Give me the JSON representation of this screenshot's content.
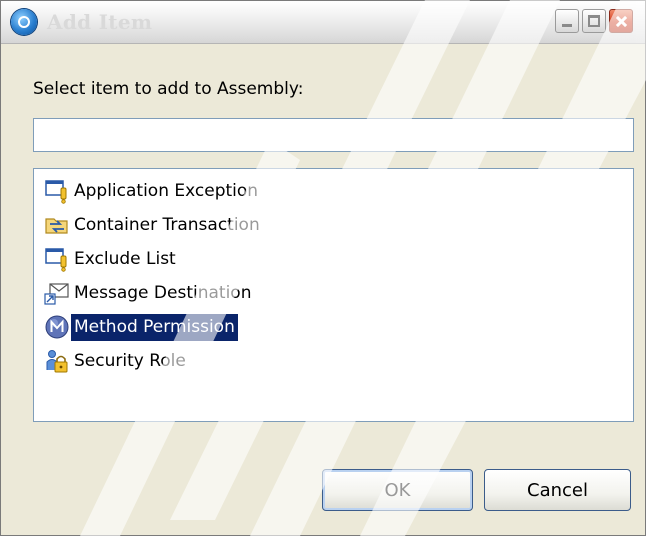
{
  "window": {
    "title": "Add Item",
    "icon": "dialog-app-icon",
    "controls": [
      "minimize-icon",
      "maximize-icon",
      "close-icon"
    ]
  },
  "prompt": "Select item to add to Assembly:",
  "filter": {
    "value": "",
    "placeholder": ""
  },
  "items": [
    {
      "label": "Application Exception",
      "icon": "exception-icon",
      "selected": false
    },
    {
      "label": "Container Transaction",
      "icon": "container-transaction-icon",
      "selected": false
    },
    {
      "label": "Exclude List",
      "icon": "exclude-list-icon",
      "selected": false
    },
    {
      "label": "Message Destination",
      "icon": "message-destination-icon",
      "selected": false
    },
    {
      "label": "Method Permission",
      "icon": "method-permission-icon",
      "selected": true
    },
    {
      "label": "Security Role",
      "icon": "security-role-icon",
      "selected": false
    }
  ],
  "buttons": {
    "ok": "OK",
    "cancel": "Cancel"
  },
  "colors": {
    "selection": "#0a246a",
    "selection_text": "#ffffff",
    "dialog_bg": "#ece9d8",
    "field_border": "#7f9db9"
  }
}
